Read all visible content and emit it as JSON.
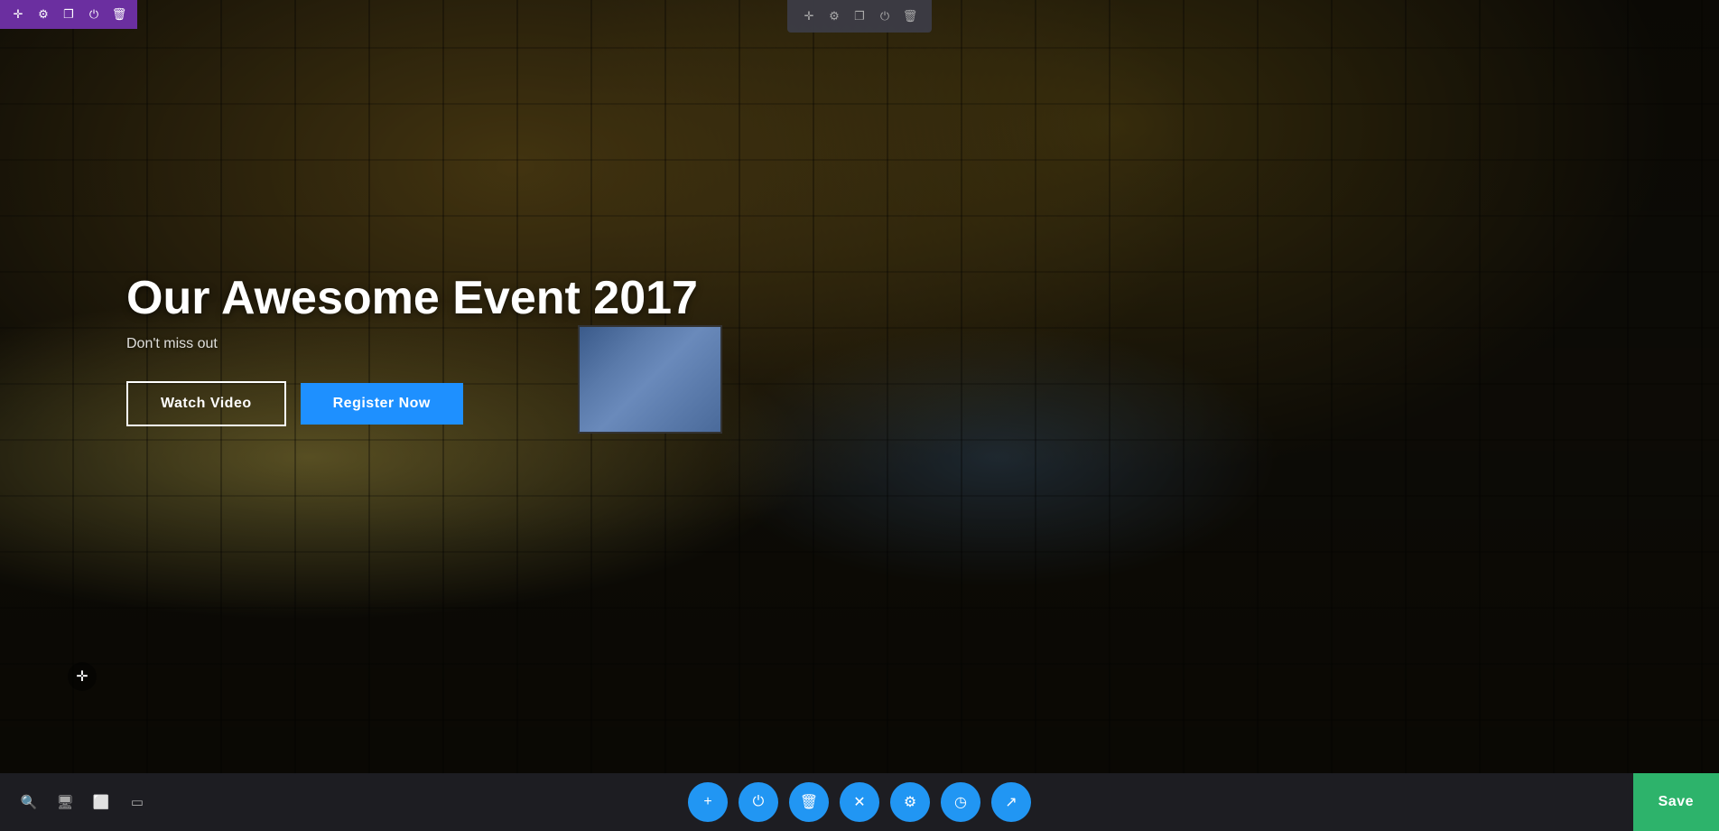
{
  "hero": {
    "title": "Our Awesome Event 2017",
    "subtitle": "Don't miss out",
    "btn_watch": "Watch Video",
    "btn_register": "Register Now"
  },
  "top_toolbar_left": {
    "buttons": [
      {
        "icon": "✛",
        "name": "move-icon"
      },
      {
        "icon": "⚙",
        "name": "settings-icon"
      },
      {
        "icon": "❐",
        "name": "duplicate-icon"
      },
      {
        "icon": "⏻",
        "name": "power-icon"
      },
      {
        "icon": "🗑",
        "name": "delete-icon"
      }
    ]
  },
  "top_toolbar_center": {
    "buttons": [
      {
        "icon": "✛",
        "name": "move-icon"
      },
      {
        "icon": "⚙",
        "name": "settings-icon"
      },
      {
        "icon": "❐",
        "name": "duplicate-icon"
      },
      {
        "icon": "⏻",
        "name": "power-icon"
      },
      {
        "icon": "🗑",
        "name": "delete-icon"
      }
    ]
  },
  "bottom_toolbar": {
    "left_tools": [
      {
        "icon": "🔍",
        "name": "search-icon"
      },
      {
        "icon": "🖥",
        "name": "desktop-icon"
      },
      {
        "icon": "📱",
        "name": "tablet-icon"
      },
      {
        "icon": "📱",
        "name": "mobile-icon"
      }
    ],
    "center_tools": [
      {
        "icon": "+",
        "name": "add-icon",
        "class": "circle-btn-add"
      },
      {
        "icon": "⏻",
        "name": "power-icon",
        "class": "circle-btn-power"
      },
      {
        "icon": "🗑",
        "name": "delete-icon",
        "class": "circle-btn-delete"
      },
      {
        "icon": "✕",
        "name": "close-icon",
        "class": "circle-btn-close"
      },
      {
        "icon": "⚙",
        "name": "settings-icon",
        "class": "circle-btn-settings"
      },
      {
        "icon": "◷",
        "name": "history-icon",
        "class": "circle-btn-history"
      },
      {
        "icon": "↗",
        "name": "launch-icon",
        "class": "circle-btn-launch"
      }
    ],
    "save_label": "Save"
  },
  "move_handle": {
    "icon": "✛"
  }
}
